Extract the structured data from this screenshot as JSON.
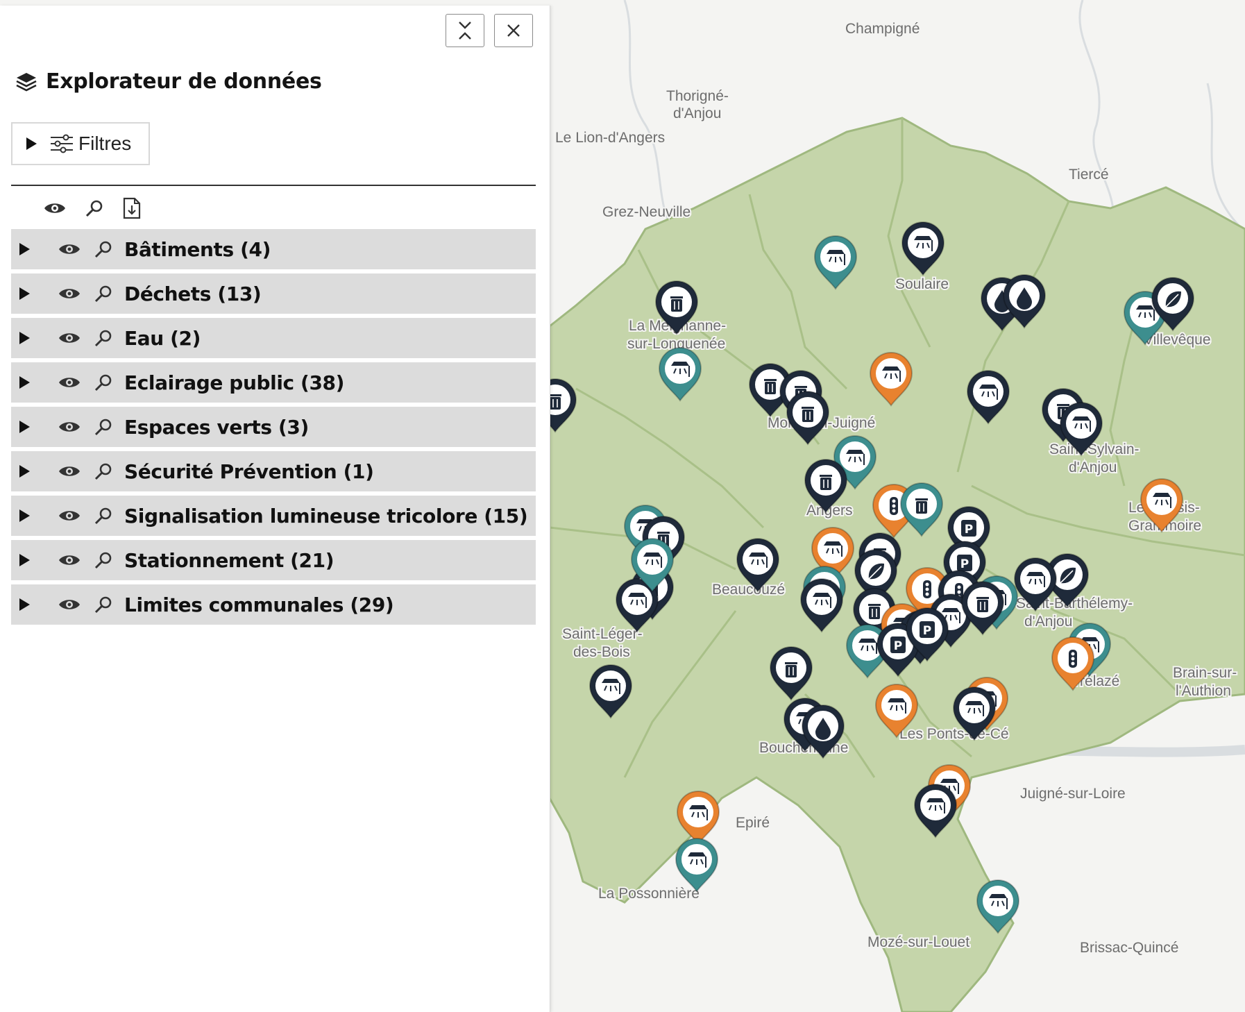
{
  "panel": {
    "title": "Explorateur de données",
    "filters_label": "Filtres",
    "collapse_label": "Réduire",
    "close_label": "Fermer"
  },
  "toolbar_icons": [
    "eye-icon",
    "zoom-icon",
    "file-download-icon"
  ],
  "layers": [
    {
      "label": "Bâtiments (4)"
    },
    {
      "label": "Déchets (13)"
    },
    {
      "label": "Eau (2)"
    },
    {
      "label": "Eclairage public (38)"
    },
    {
      "label": "Espaces verts (3)"
    },
    {
      "label": "Sécurité Prévention (1)"
    },
    {
      "label": "Signalisation lumineuse tricolore (15)"
    },
    {
      "label": "Stationnement (21)"
    },
    {
      "label": "Limites communales (29)"
    }
  ],
  "map": {
    "colors": {
      "territory": "#c5d5aa",
      "border": "#9fb87f",
      "navy": "#1f2a3a",
      "teal": "#3d8e8e",
      "orange": "#e8822f",
      "background": "#f4f4f2"
    },
    "place_labels": [
      "Champigné",
      "Thorigné-",
      "d'Anjou",
      "Le Lion-d'Angers",
      "Tiercé",
      "Grez-Neuville",
      "Soulaire",
      "La Meignanne-",
      "sur-Longuenée",
      "Villevêque",
      "Saint-Sylvain-",
      "d'Anjou",
      "Le Plessis-",
      "Grammoire",
      "Saint-Léger-",
      "des-Bois",
      "Beaucouzé",
      "Brain-sur-",
      "l'Authion",
      "Trélazé",
      "Les Ponts-de-Cé",
      "Bouchemaine",
      "Epiré",
      "Juigné-sur-Loire",
      "La Possonnière",
      "Mozé-sur-Louet",
      "Brissac-Quincé",
      "Angers",
      "Montreuil-Juigné",
      "Saint-Barthélemy-",
      "d'Anjou"
    ]
  }
}
